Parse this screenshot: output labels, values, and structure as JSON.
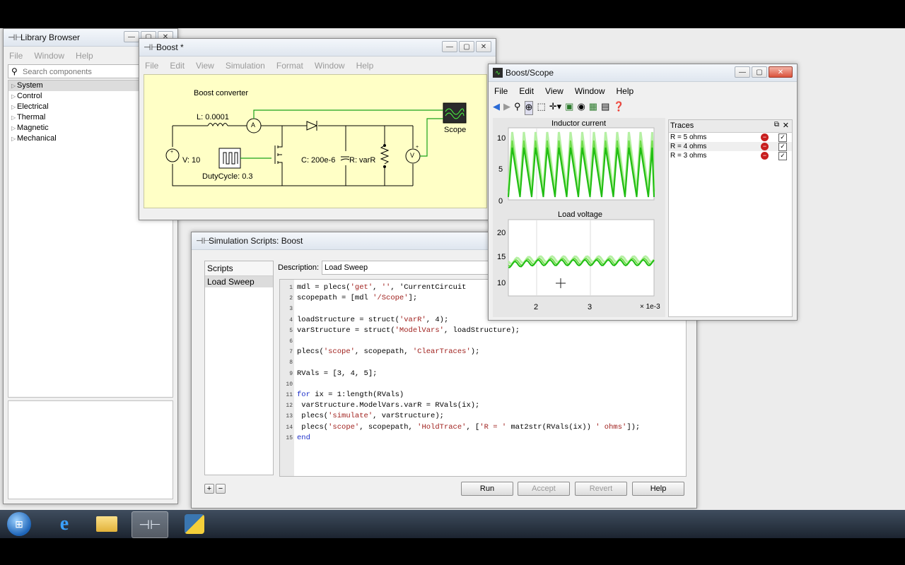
{
  "library_browser": {
    "title": "Library Browser",
    "menu": [
      "File",
      "Window",
      "Help"
    ],
    "search_placeholder": "Search components",
    "tree": [
      "System",
      "Control",
      "Electrical",
      "Thermal",
      "Magnetic",
      "Mechanical"
    ]
  },
  "boost": {
    "title": "Boost *",
    "menu": [
      "File",
      "Edit",
      "View",
      "Simulation",
      "Format",
      "Window",
      "Help"
    ],
    "schematic": {
      "heading": "Boost converter",
      "inductor": "L: 0.0001",
      "source": "V: 10",
      "duty": "DutyCycle: 0.3",
      "capacitor": "C: 200e-6",
      "resistor": "R: varR",
      "ammeter": "A",
      "voltmeter": "V",
      "scope": "Scope"
    }
  },
  "scripts": {
    "title": "Simulation Scripts: Boost",
    "list_header": "Scripts",
    "items": [
      "Load Sweep"
    ],
    "description_label": "Description:",
    "description_value": "Load Sweep",
    "buttons": {
      "run": "Run",
      "accept": "Accept",
      "revert": "Revert",
      "help": "Help"
    },
    "add": "+",
    "remove": "−",
    "code_lines": [
      {
        "n": "1",
        "t": "mdl = plecs('get', '', 'CurrentCircuit"
      },
      {
        "n": "2",
        "t": "scopepath = [mdl '/Scope'];"
      },
      {
        "n": "3",
        "t": ""
      },
      {
        "n": "4",
        "t": "loadStructure = struct('varR', 4);"
      },
      {
        "n": "5",
        "t": "varStructure = struct('ModelVars', loadStructure);"
      },
      {
        "n": "6",
        "t": ""
      },
      {
        "n": "7",
        "t": "plecs('scope', scopepath, 'ClearTraces');"
      },
      {
        "n": "8",
        "t": ""
      },
      {
        "n": "9",
        "t": "RVals = [3, 4, 5];"
      },
      {
        "n": "10",
        "t": ""
      },
      {
        "n": "11",
        "t": "for ix = 1:length(RVals)"
      },
      {
        "n": "12",
        "t": " varStructure.ModelVars.varR = RVals(ix);"
      },
      {
        "n": "13",
        "t": " plecs('simulate', varStructure);"
      },
      {
        "n": "14",
        "t": " plecs('scope', scopepath, 'HoldTrace', ['R = ' mat2str(RVals(ix)) ' ohms']);"
      },
      {
        "n": "15",
        "t": "end"
      }
    ]
  },
  "scope": {
    "title": "Boost/Scope",
    "menu": [
      "File",
      "Edit",
      "View",
      "Window",
      "Help"
    ],
    "plot1_title": "Inductor current",
    "plot1_ticks": [
      "10",
      "5",
      "0"
    ],
    "plot2_title": "Load voltage",
    "plot2_ticks": [
      "20",
      "15",
      "10"
    ],
    "x_ticks": [
      "2",
      "3"
    ],
    "x_scale": "× 1e-3",
    "traces_title": "Traces",
    "traces": [
      {
        "label": "R = 5 ohms",
        "checked": true
      },
      {
        "label": "R = 4 ohms",
        "checked": true
      },
      {
        "label": "R = 3 ohms",
        "checked": true
      }
    ],
    "colors": {
      "trace1": "#b6f0a4",
      "trace2": "#6fdc4a",
      "trace3": "#1fbd12",
      "plot_bg": "#ffffff"
    }
  },
  "taskbar": {
    "items": [
      "start-orb",
      "internet-explorer",
      "file-explorer",
      "plecs",
      "python"
    ]
  }
}
